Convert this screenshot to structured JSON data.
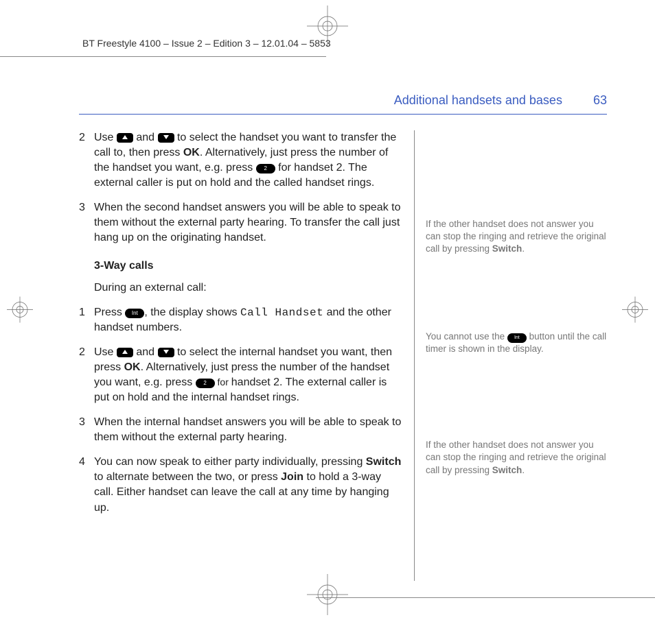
{
  "meta": {
    "header": "BT Freestyle 4100 – Issue 2 – Edition 3 – 12.01.04 – 5853"
  },
  "header": {
    "section": "Additional handsets and bases",
    "page": "63"
  },
  "main": {
    "step2a_a": "Use ",
    "step2a_b": " and ",
    "step2a_c": " to select the handset you want to transfer the call to, then press ",
    "ok": "OK",
    "step2a_d": ". Alternatively, just press the number of the handset you want, e.g. press ",
    "step2a_e": " for handset 2. The external caller is put on hold and the called handset rings.",
    "step3a": "When the second handset answers you will be able to speak to them without the external party hearing. To transfer the call just hang up on the originating handset.",
    "subhead": "3-Way calls",
    "intro": "During an external call:",
    "step1b_a": "Press ",
    "step1b_b": ", the display shows ",
    "callhandset": "Call Handset",
    "step1b_c": " and the other handset numbers.",
    "step2b_a": "Use ",
    "step2b_b": " and ",
    "step2b_c": " to select the internal handset you want, then press ",
    "step2b_d": ". Alternatively, just press the number of the handset you want, e.g. press ",
    "step2b_for": " for ",
    "step2b_e": "handset 2. The external caller is put on hold and the internal handset rings.",
    "step3b": "When the internal handset answers you will be able to speak to them without the external party hearing.",
    "step4_a": "You can now speak to either party individually, pressing ",
    "switch": "Switch",
    "step4_b": " to alternate between the two, or press ",
    "join": "Join",
    "step4_c": " to hold a 3-way call. Either handset can leave the call at any time by hanging up.",
    "key2": "2",
    "keyInt": "Int",
    "n2": "2",
    "n3": "3",
    "n1": "1",
    "n4": "4"
  },
  "side": {
    "note1_a": "If the other handset does not answer you can stop the ringing and retrieve the original call by pressing ",
    "note1_b": ".",
    "note2_a": "You cannot use the ",
    "note2_b": " button until the call timer is shown in the display.",
    "note3_a": "If the other handset does not answer you can stop the ringing and retrieve the original call by pressing ",
    "note3_b": "."
  }
}
